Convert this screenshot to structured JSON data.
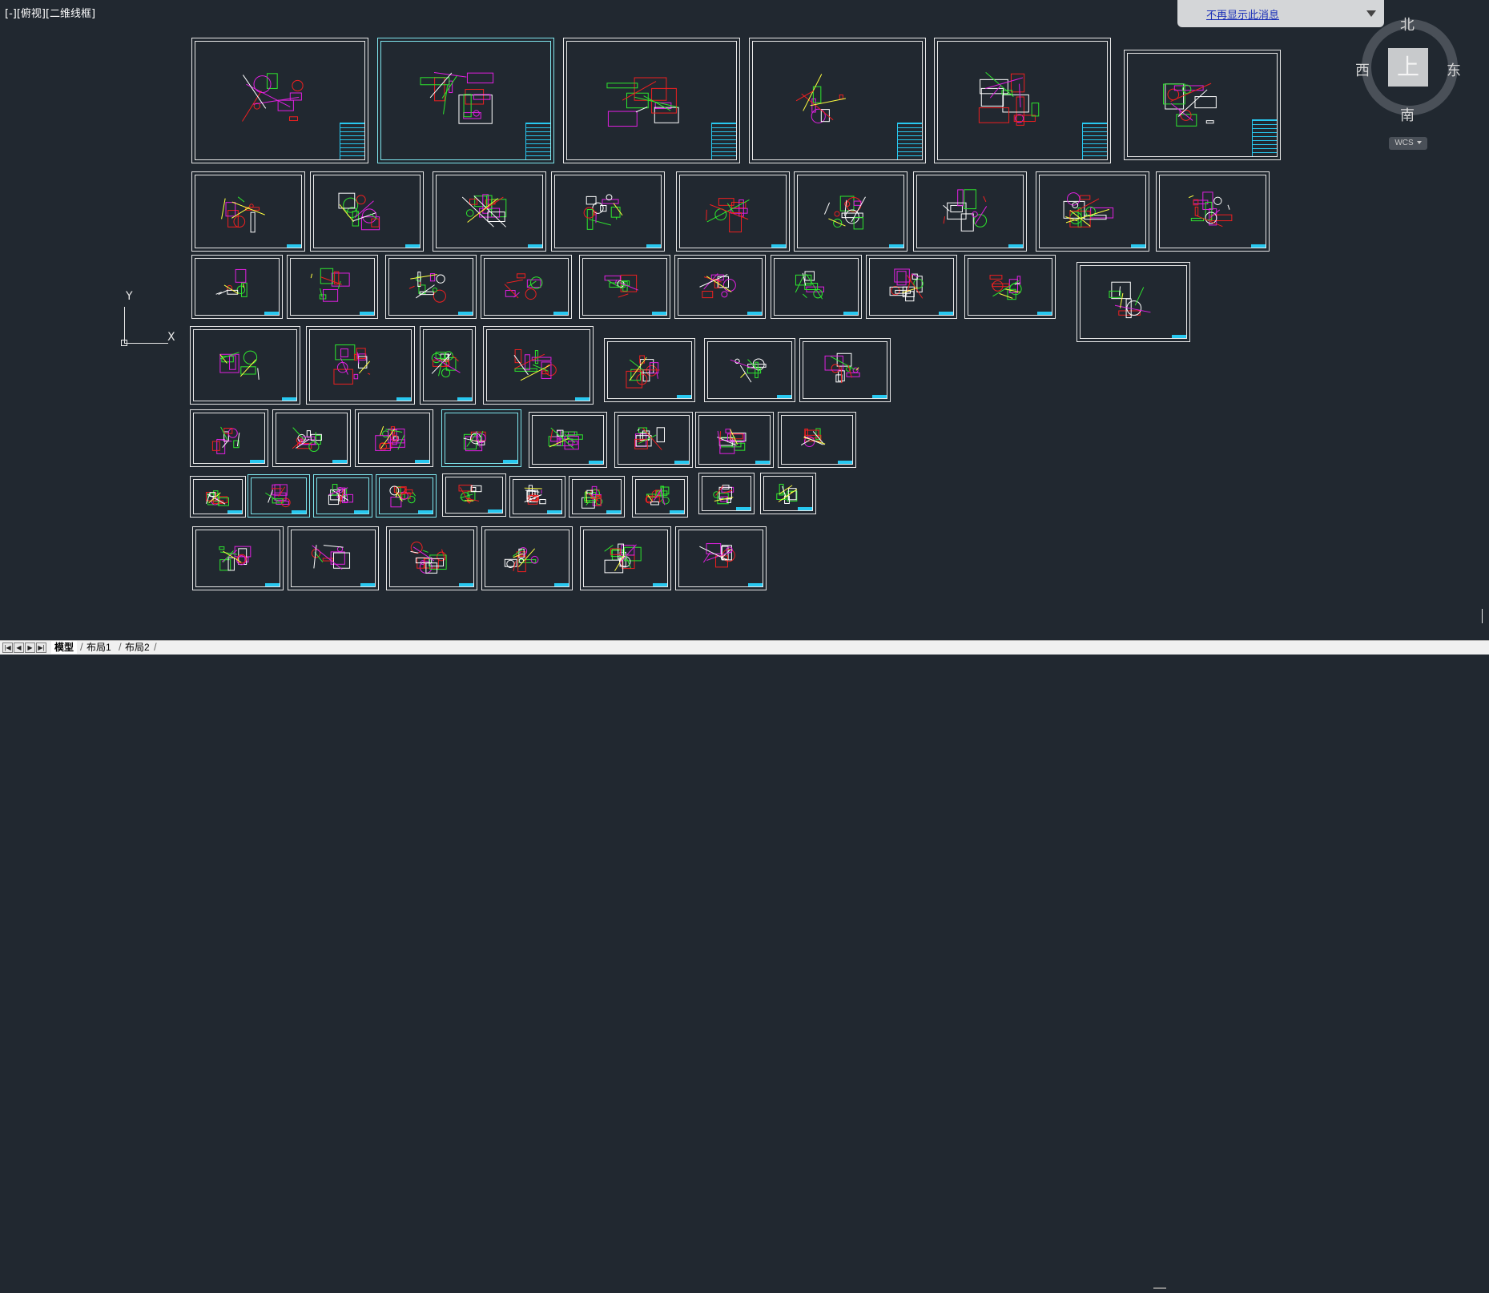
{
  "viewport": {
    "label": "[-][俯视][二维线框]"
  },
  "notification": {
    "link_text": "不再显示此消息"
  },
  "viewcube": {
    "north": "北",
    "south": "南",
    "west": "西",
    "east": "东",
    "face": "上",
    "wcs_label": "WCS"
  },
  "ucs": {
    "x_label": "X",
    "y_label": "Y"
  },
  "tabs": [
    {
      "label": "模型",
      "active": true
    },
    {
      "label": "布局1",
      "active": false
    },
    {
      "label": "布局2",
      "active": false
    }
  ],
  "colors": {
    "background": "#212830",
    "frame": "#e8e8e8",
    "cyan": "#28c8f0",
    "green": "#2ee62e",
    "red": "#ee2020",
    "magenta": "#e020e0",
    "yellow": "#ffff40",
    "white": "#ffffff"
  }
}
